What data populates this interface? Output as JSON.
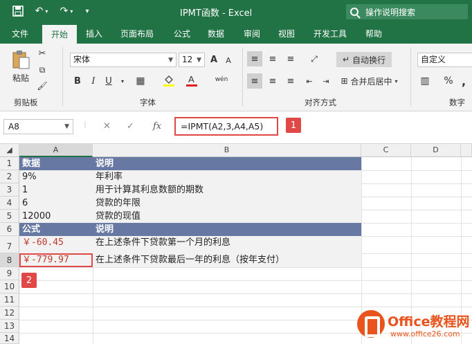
{
  "window": {
    "title": "IPMT函数 - Excel",
    "search_placeholder": "操作说明搜索"
  },
  "menu": {
    "items": [
      "文件",
      "开始",
      "插入",
      "页面布局",
      "公式",
      "数据",
      "审阅",
      "视图",
      "开发工具",
      "帮助"
    ],
    "active_index": 1
  },
  "ribbon": {
    "paste_label": "粘贴",
    "clipboard_label": "剪贴板",
    "font_name": "宋体",
    "font_size": "12",
    "font_group_label": "字体",
    "wrap_text_label": "自动换行",
    "merge_center_label": "合并后居中",
    "alignment_group_label": "对齐方式",
    "number_format": "自定义",
    "number_group_label": "数字",
    "bold": "B",
    "italic": "I",
    "underline": "U",
    "grow_font": "A",
    "shrink_font": "A",
    "percent": "%",
    "comma": ","
  },
  "formula_bar": {
    "name_box": "A8",
    "formula": "=IPMT(A2,3,A4,A5)",
    "badge1": "1",
    "fx": "fx"
  },
  "sheet": {
    "columns": [
      "A",
      "B",
      "C",
      "D"
    ],
    "rows": [
      "1",
      "2",
      "3",
      "4",
      "5",
      "6",
      "7",
      "8",
      "9",
      "10",
      "11",
      "12",
      "13",
      "14"
    ],
    "cells": {
      "A1": "数据",
      "B1": "说明",
      "A2": "9%",
      "B2": "年利率",
      "A3": "1",
      "B3": "用于计算其利息数额的期数",
      "A4": "6",
      "B4": "贷款的年限",
      "A5": "12000",
      "B5": "贷款的现值",
      "A6": "公式",
      "B6": "说明",
      "A7": "￥-60.45",
      "B7": "在上述条件下贷款第一个月的利息",
      "A8": "￥-779.97",
      "B8": "在上述条件下贷款最后一年的利息（按年支付）"
    },
    "badge2": "2"
  },
  "watermark": {
    "line1": "Office教程网",
    "line2": "www.office26.com"
  },
  "colors": {
    "excel_green": "#217346",
    "header_fill": "#6779a3",
    "highlight_red": "#e04848",
    "negative_red": "#c0392b"
  }
}
